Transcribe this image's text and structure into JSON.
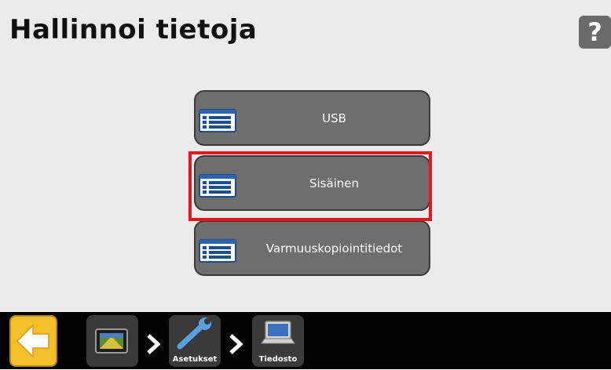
{
  "page": {
    "title": "Hallinnoi tietoja",
    "help_symbol": "?"
  },
  "menu": {
    "items": [
      {
        "label": "USB",
        "icon": "list-icon"
      },
      {
        "label": "Sisäinen",
        "icon": "list-icon",
        "selected": true
      },
      {
        "label": "Varmuuskopiointitiedot",
        "icon": "list-icon"
      }
    ]
  },
  "nav": {
    "breadcrumbs": [
      {
        "icon": "home-screen-icon",
        "label": ""
      },
      {
        "icon": "wrench-icon",
        "label": "Asetukset"
      },
      {
        "icon": "laptop-icon",
        "label": "Tiedosto"
      }
    ]
  },
  "colors": {
    "background": "#ebebeb",
    "button": "#6e6e6e",
    "selection": "#e8161c",
    "back_button": "#f5bf2a",
    "bottom_bar": "#020202"
  }
}
